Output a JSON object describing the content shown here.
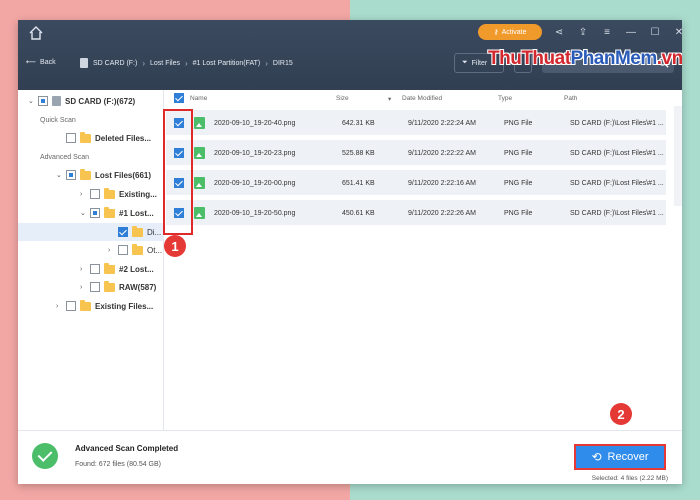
{
  "titlebar": {
    "activate_label": "Activate"
  },
  "watermark": {
    "part1": "ThuThuat",
    "part2": "PhanMem",
    "part3": ".vn"
  },
  "nav": {
    "back_label": "Back",
    "breadcrumb": [
      "SD CARD (F:)",
      "Lost Files",
      "#1 Lost Partition(FAT)",
      "DIR15"
    ],
    "filter_label": "Filter"
  },
  "sidebar": {
    "root_label": "SD CARD (F:)(672)",
    "quick_scan_header": "Quick Scan",
    "deleted_files": "Deleted Files...",
    "advanced_scan_header": "Advanced Scan",
    "lost_files": "Lost Files(661)",
    "existing": "Existing...",
    "lost_partition_1": "#1 Lost...",
    "dir_item": "Di...",
    "other_item": "Ot...",
    "lost_partition_2": "#2 Lost...",
    "raw": "RAW(587)",
    "existing_files": "Existing Files..."
  },
  "table": {
    "headers": {
      "name": "Name",
      "size": "Size",
      "date": "Date Modified",
      "type": "Type",
      "path": "Path"
    },
    "rows": [
      {
        "name": "2020-09-10_19-20-40.png",
        "size": "642.31 KB",
        "date": "9/11/2020 2:22:24 AM",
        "type": "PNG File",
        "path": "SD CARD (F:)\\Lost Files\\#1 ..."
      },
      {
        "name": "2020-09-10_19-20-23.png",
        "size": "525.88 KB",
        "date": "9/11/2020 2:22:22 AM",
        "type": "PNG File",
        "path": "SD CARD (F:)\\Lost Files\\#1 ..."
      },
      {
        "name": "2020-09-10_19-20-00.png",
        "size": "651.41 KB",
        "date": "9/11/2020 2:22:16 AM",
        "type": "PNG File",
        "path": "SD CARD (F:)\\Lost Files\\#1 ..."
      },
      {
        "name": "2020-09-10_19-20-50.png",
        "size": "450.61 KB",
        "date": "9/11/2020 2:22:26 AM",
        "type": "PNG File",
        "path": "SD CARD (F:)\\Lost Files\\#1 ..."
      }
    ]
  },
  "status": {
    "title": "Advanced Scan Completed",
    "found": "Found: 672 files (80.54 GB)",
    "recover_label": "Recover",
    "selected": "Selected: 4 files (2.22 MB)"
  },
  "annotations": {
    "badge1": "1",
    "badge2": "2"
  },
  "colors": {
    "accent": "#2f8ceb",
    "highlight": "#e53935",
    "activate": "#f19a2c"
  }
}
